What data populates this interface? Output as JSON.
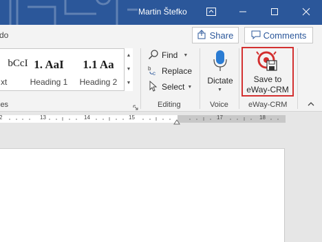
{
  "titlebar": {
    "user_name": "Martin Štefko",
    "minimize_icon": "minimize-icon",
    "maximize_icon": "maximize-icon",
    "close_icon": "close-icon",
    "restore_icon": "ribbon-display-options-icon",
    "bg_color": "#2b579a"
  },
  "share_row": {
    "left_fragment": "do",
    "share_label": "Share",
    "comments_label": "Comments"
  },
  "ribbon": {
    "styles": {
      "items": [
        {
          "preview": "bCcI",
          "name": "xt"
        },
        {
          "preview": "1. AaI",
          "name": "Heading 1"
        },
        {
          "preview": "1.1 Aa",
          "name": "Heading 2"
        }
      ],
      "group_label": "les"
    },
    "editing": {
      "find_label": "Find",
      "replace_label": "Replace",
      "select_label": "Select",
      "group_label": "Editing"
    },
    "voice": {
      "dictate_label": "Dictate",
      "group_label": "Voice"
    },
    "eway": {
      "save_label_line1": "Save to",
      "save_label_line2": "eWay-CRM",
      "group_label": "eWay-CRM",
      "highlight_color": "#d32f2f"
    }
  },
  "ruler": {
    "numbers": [
      "2",
      "13",
      "14",
      "15",
      "17",
      "18"
    ]
  }
}
